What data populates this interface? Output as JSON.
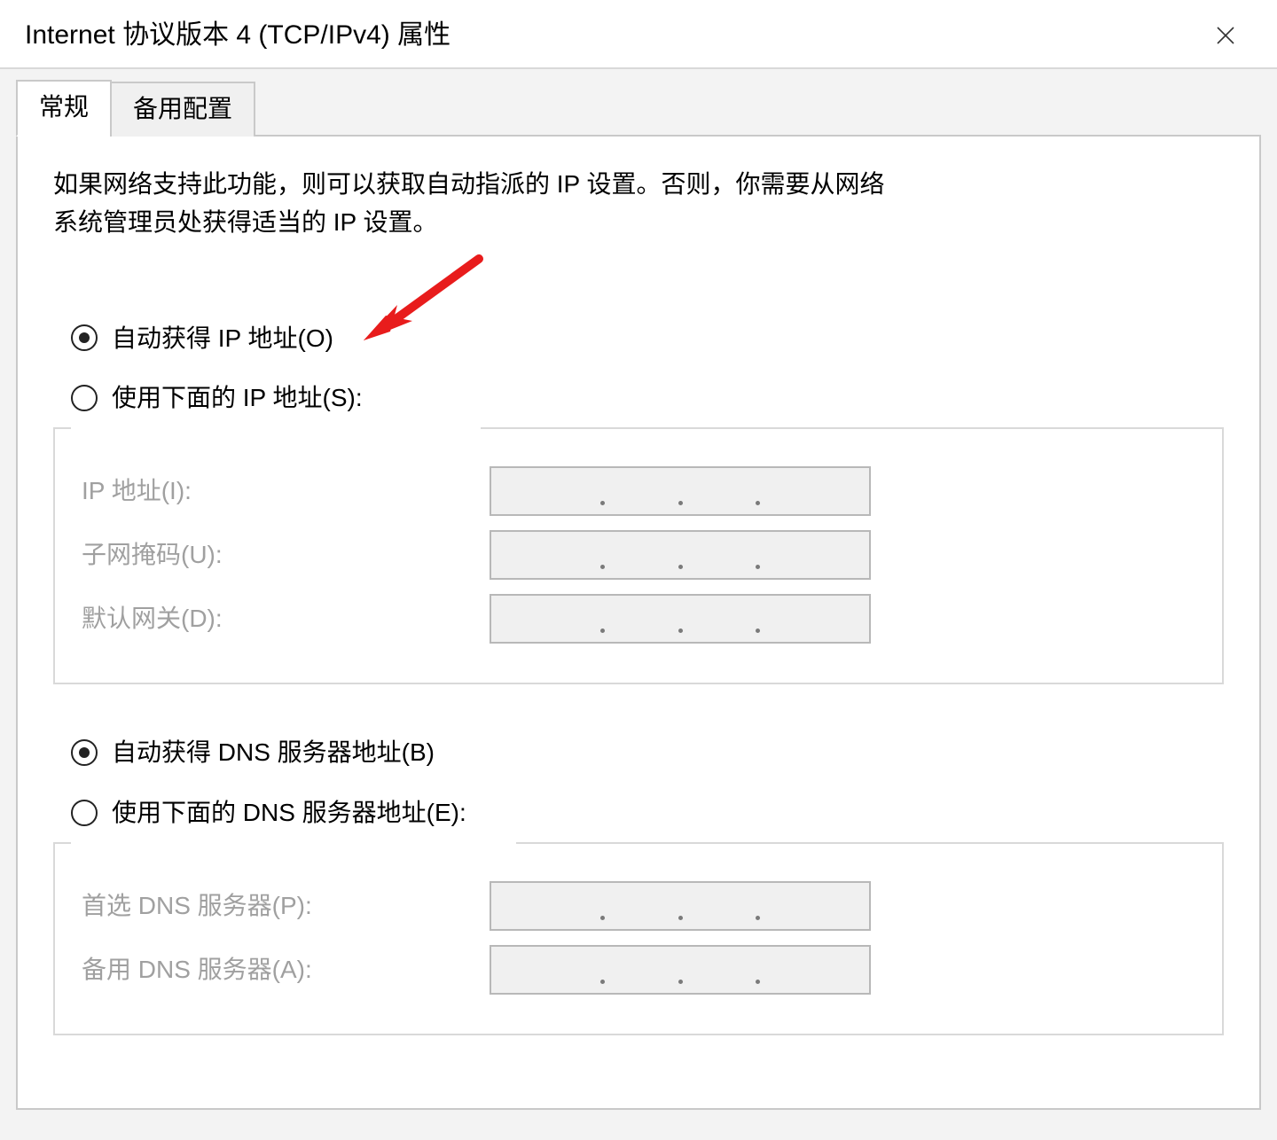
{
  "window": {
    "title": "Internet 协议版本 4 (TCP/IPv4) 属性"
  },
  "tabs": {
    "general": "常规",
    "alternate": "备用配置",
    "active": "general"
  },
  "intro_text": "如果网络支持此功能，则可以获取自动指派的 IP 设置。否则，你需要从网络系统管理员处获得适当的 IP 设置。",
  "ip_group": {
    "radio_auto": {
      "label": "自动获得 IP 地址(O)",
      "selected": true
    },
    "radio_manual": {
      "label": "使用下面的 IP 地址(S):",
      "selected": false
    },
    "fields": {
      "ip_address": {
        "label": "IP 地址(I):",
        "value": ""
      },
      "subnet_mask": {
        "label": "子网掩码(U):",
        "value": ""
      },
      "default_gateway": {
        "label": "默认网关(D):",
        "value": ""
      }
    }
  },
  "dns_group": {
    "radio_auto": {
      "label": "自动获得 DNS 服务器地址(B)",
      "selected": true
    },
    "radio_manual": {
      "label": "使用下面的 DNS 服务器地址(E):",
      "selected": false
    },
    "fields": {
      "preferred_dns": {
        "label": "首选 DNS 服务器(P):",
        "value": ""
      },
      "alternate_dns": {
        "label": "备用 DNS 服务器(A):",
        "value": ""
      }
    }
  },
  "annotation": {
    "arrow_target": "radio-auto-ip",
    "color": "#e81c1c"
  }
}
